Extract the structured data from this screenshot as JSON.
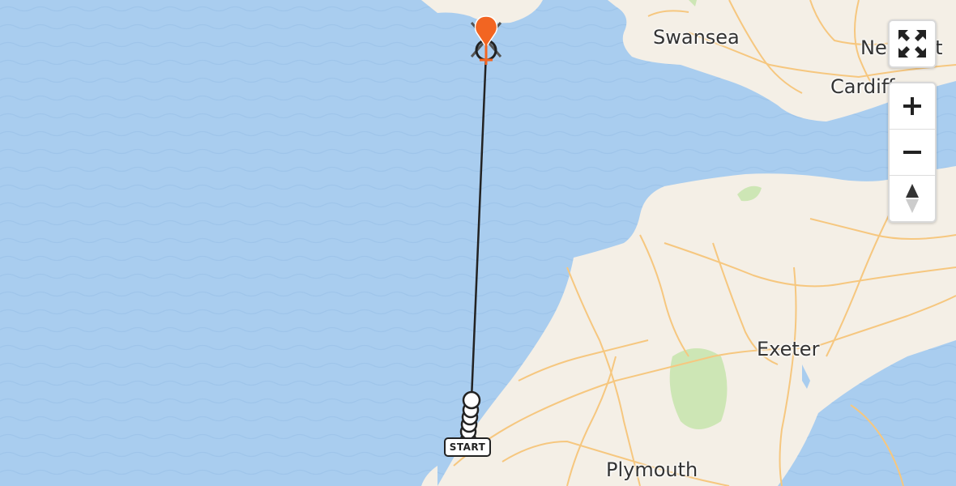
{
  "map": {
    "cities": [
      {
        "id": "swansea",
        "name": "Swansea"
      },
      {
        "id": "newport",
        "name": "Newport"
      },
      {
        "id": "cardiff",
        "name": "Cardiff"
      },
      {
        "id": "exeter",
        "name": "Exeter"
      },
      {
        "id": "plymouth",
        "name": "Plymouth"
      }
    ],
    "start_label": "START",
    "colors": {
      "sea": "#a9cdef",
      "land": "#f4efe6",
      "roads": "#f6c77f",
      "park": "#cde6b5",
      "track": "#222222",
      "destination_marker": "#f26522"
    }
  },
  "controls": {
    "fullscreen_icon": "expand-arrows-icon",
    "zoom_in_icon": "plus-icon",
    "zoom_out_icon": "minus-icon",
    "compass_icon": "compass-north-icon"
  }
}
